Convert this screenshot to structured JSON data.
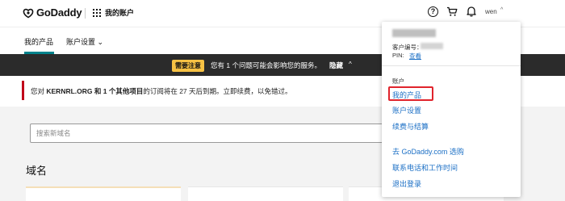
{
  "header": {
    "logo_text": "GoDaddy",
    "section_title": "我的账户",
    "help_symbol": "?",
    "user_name": "wen",
    "user_chevron": "^",
    "icons": [
      "godaddy-logo-icon",
      "apps-grid-icon",
      "help-icon",
      "cart-icon",
      "bell-icon"
    ]
  },
  "subnav": {
    "active_tab": "我的产品",
    "settings_tab": "账户设置 ⌄",
    "accent_color": "#00838c"
  },
  "alert": {
    "badge": "需要注意",
    "message": "您有 1 个问题可能会影响您的服务。",
    "hide_label": "隐藏",
    "chevron": "^",
    "badge_color": "#f7c244"
  },
  "renewal": {
    "prefix": "您对 ",
    "domain": "KERNRL.ORG",
    "middle1": " 和 ",
    "others": "1 个其他项目",
    "suffix": "的订阅将在 27 天后到期。立即续费，以免错过。",
    "accent_color": "#c0001a"
  },
  "main": {
    "search_placeholder": "搜索新域名",
    "section_title": "域名"
  },
  "dropdown": {
    "customer_id_label": "客户编号：",
    "pin_label": "PIN:",
    "pin_link": "查看",
    "section_label": "账户",
    "links": [
      "我的产品",
      "账户设置",
      "续费与结算",
      "去 GoDaddy.com 选购",
      "联系电话和工作时间",
      "退出登录"
    ],
    "highlight_color": "#e0242c",
    "link_color": "#1b6fc5"
  }
}
